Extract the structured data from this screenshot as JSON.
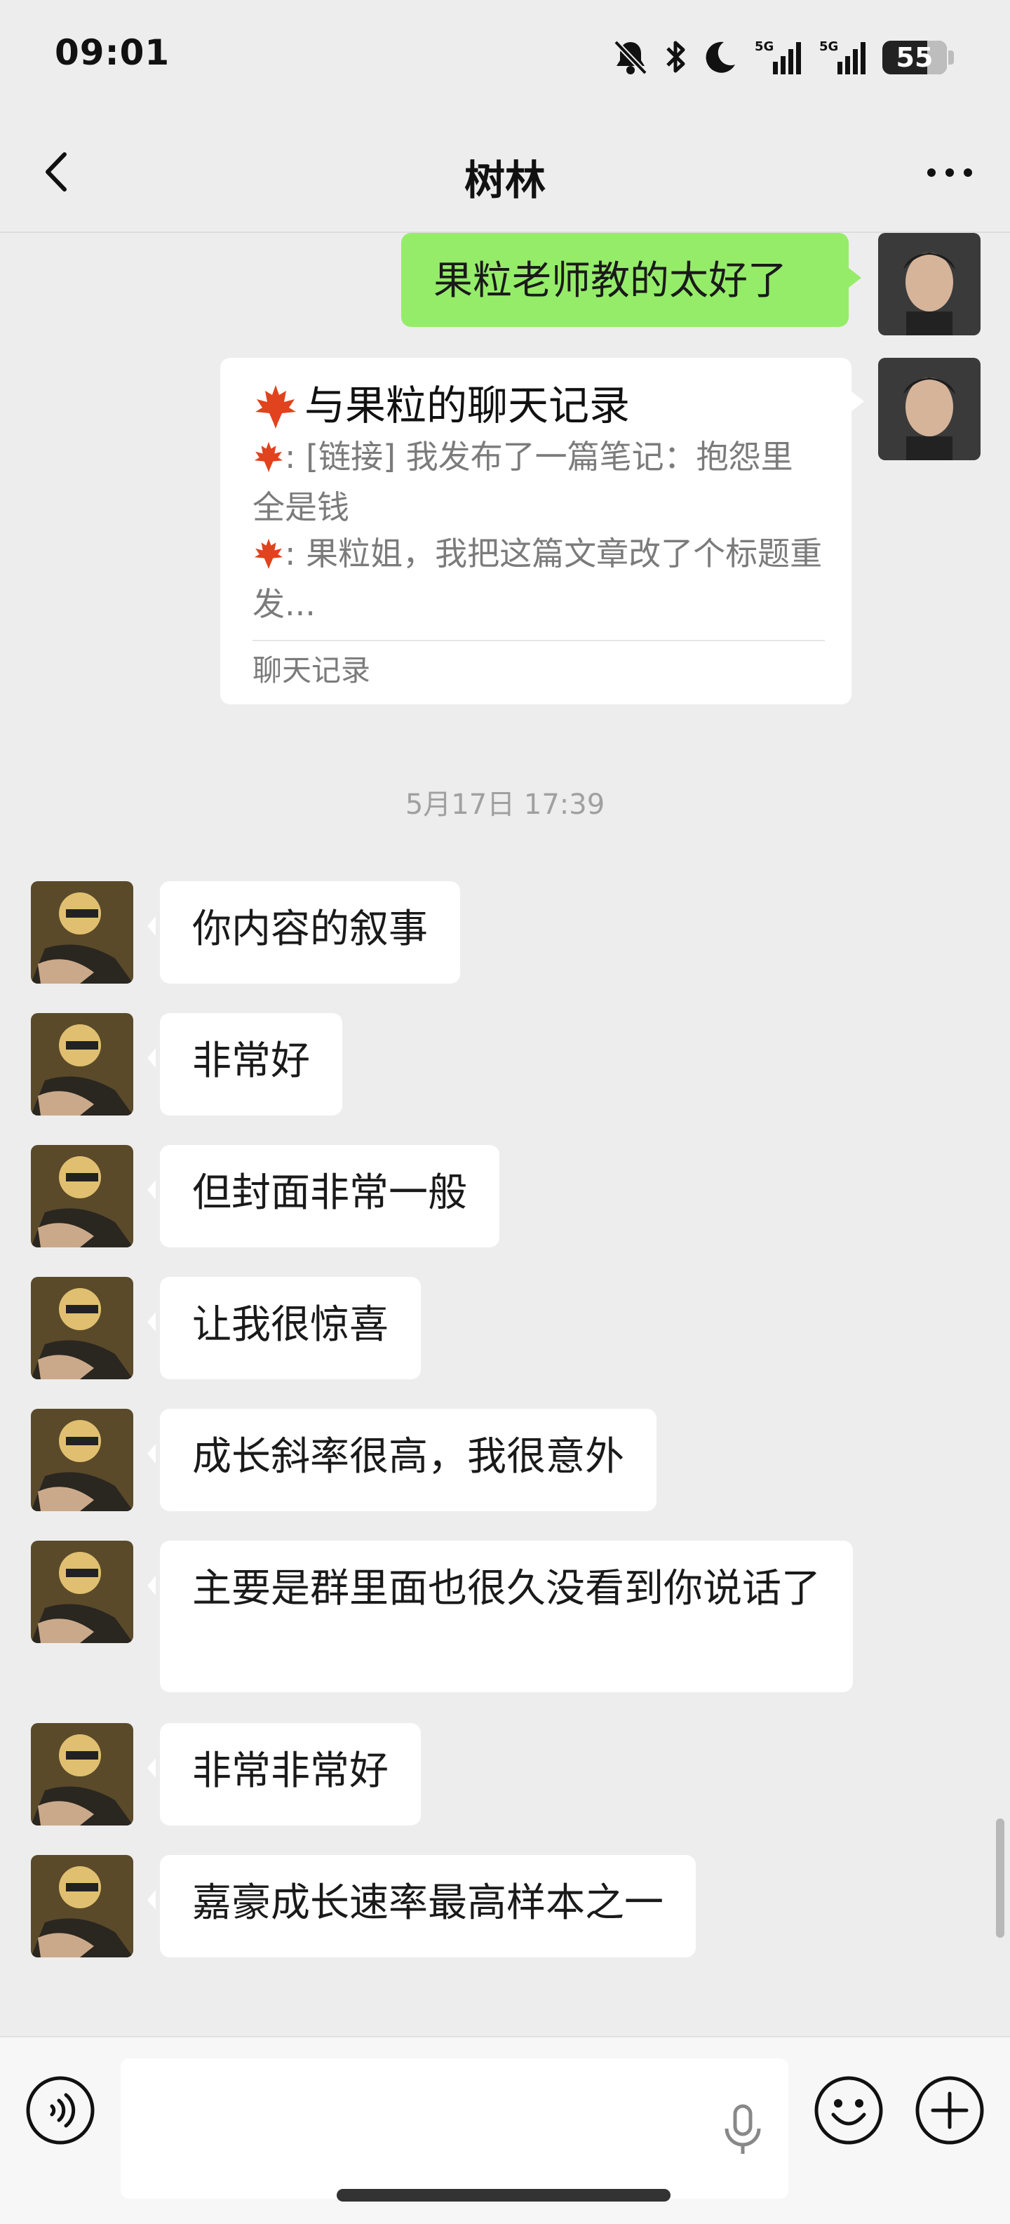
{
  "status_bar": {
    "time": "09:01",
    "battery": "55",
    "network": "5G",
    "icons": [
      "mute-icon",
      "bluetooth-icon",
      "moon-icon",
      "signal-5g-icon",
      "signal-5g-icon",
      "battery-icon"
    ]
  },
  "header": {
    "title": "树林",
    "back_icon": "chevron-left-icon",
    "more_icon": "more-dots-icon"
  },
  "messages": [
    {
      "side": "right",
      "type": "text",
      "text": "果粒老师教的太好了"
    },
    {
      "side": "right",
      "type": "chat_record",
      "title": "与果粒的聊天记录",
      "title_icon": "maple-leaf-icon",
      "line1": ": [链接] 我发布了一篇笔记：抱怨里全是钱",
      "line2": ": 果粒姐，我把这篇文章改了个标题重发...",
      "footer": "聊天记录"
    },
    {
      "type": "timestamp",
      "text": "5月17日 17:39"
    },
    {
      "side": "left",
      "type": "text",
      "text": "你内容的叙事"
    },
    {
      "side": "left",
      "type": "text",
      "text": "非常好"
    },
    {
      "side": "left",
      "type": "text",
      "text": "但封面非常一般"
    },
    {
      "side": "left",
      "type": "text",
      "text": "让我很惊喜"
    },
    {
      "side": "left",
      "type": "text",
      "text": "成长斜率很高，我很意外"
    },
    {
      "side": "left",
      "type": "text",
      "text": "主要是群里面也很久没看到你说话了"
    },
    {
      "side": "left",
      "type": "text",
      "text": "非常非常好"
    },
    {
      "side": "left",
      "type": "text",
      "text": "嘉豪成长速率最高样本之一"
    }
  ],
  "input_bar": {
    "placeholder": "",
    "icons": [
      "voice-icon",
      "mic-icon",
      "emoji-icon",
      "plus-icon"
    ]
  },
  "colors": {
    "background": "#ededed",
    "outgoing_bubble": "#95ec69",
    "incoming_bubble": "#ffffff",
    "muted_text": "#7b7b7b"
  }
}
